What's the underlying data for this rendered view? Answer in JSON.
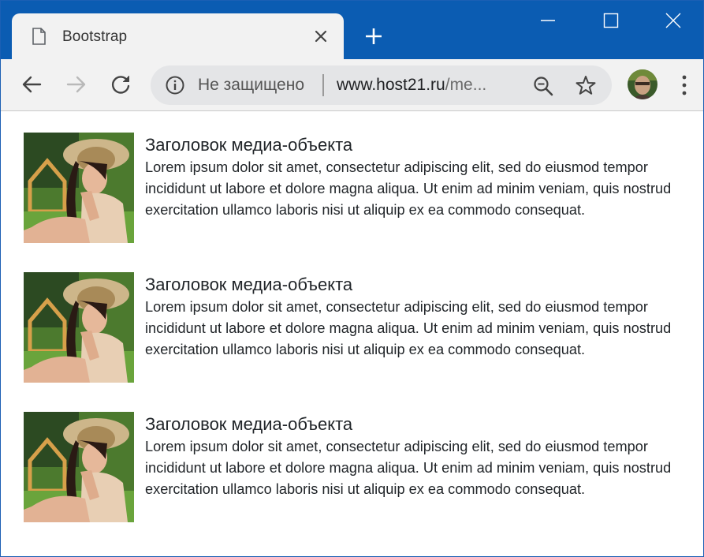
{
  "browser": {
    "tab_title": "Bootstrap",
    "security_label": "Не защищено",
    "url_host": "www.host21.ru",
    "url_path": "/me..."
  },
  "media_items": [
    {
      "heading": "Заголовок медиа-объекта",
      "text": "Lorem ipsum dolor sit amet, consectetur adipiscing elit, sed do eiusmod tempor incididunt ut labore et dolore magna aliqua. Ut enim ad minim veniam, quis nostrud exercitation ullamco laboris nisi ut aliquip ex ea commodo consequat."
    },
    {
      "heading": "Заголовок медиа-объекта",
      "text": "Lorem ipsum dolor sit amet, consectetur adipiscing elit, sed do eiusmod tempor incididunt ut labore et dolore magna aliqua. Ut enim ad minim veniam, quis nostrud exercitation ullamco laboris nisi ut aliquip ex ea commodo consequat."
    },
    {
      "heading": "Заголовок медиа-объекта",
      "text": "Lorem ipsum dolor sit amet, consectetur adipiscing elit, sed do eiusmod tempor incididunt ut labore et dolore magna aliqua. Ut enim ad minim veniam, quis nostrud exercitation ullamco laboris nisi ut aliquip ex ea commodo consequat."
    }
  ],
  "colors": {
    "titlebar": "#0b5cb2",
    "toolbar": "#f2f2f2",
    "omnibox": "#e4e5e7"
  },
  "icons": {
    "tab": "file-icon",
    "tab_close": "close-icon",
    "new_tab": "plus-icon",
    "minimize": "minimize-icon",
    "maximize": "maximize-icon",
    "close": "close-icon",
    "back": "back-arrow-icon",
    "forward": "forward-arrow-icon",
    "reload": "reload-icon",
    "info": "info-icon",
    "zoom": "zoom-out-icon",
    "bookmark": "star-icon",
    "menu": "kebab-menu-icon"
  }
}
